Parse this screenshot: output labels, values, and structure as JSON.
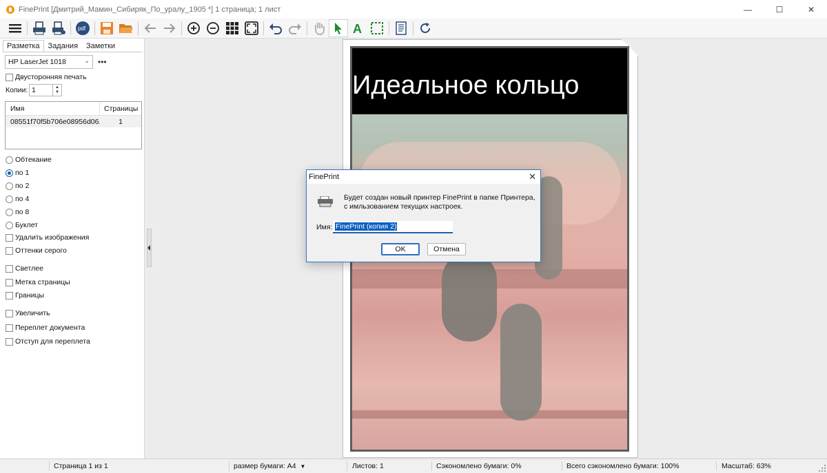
{
  "window": {
    "title": "FinePrint [Дмитрий_Мамин_Сибиряк_По_уралу_1905 *] 1 страница; 1 лист",
    "minimize": "—",
    "maximize": "☐",
    "close": "✕"
  },
  "toolbar": {
    "items": [
      "menu-icon",
      "print-icon",
      "print-settings-icon",
      "pdf-pro-icon",
      "save-icon",
      "open-folder-icon",
      "back-icon",
      "forward-icon",
      "zoom-in-icon",
      "zoom-out-icon",
      "grid-icon",
      "fit-page-icon",
      "undo-icon",
      "redo-icon",
      "hand-icon",
      "select-arrow-icon",
      "text-tool-icon",
      "marquee-icon",
      "page-setup-icon",
      "refresh-icon"
    ],
    "pdf_label": "pdf",
    "text_tool_glyph": "A"
  },
  "panel": {
    "tabs": [
      "Разметка",
      "Задания",
      "Заметки"
    ],
    "printer": "HP LaserJet 1018",
    "more": "•••",
    "duplex_label": "Двусторонняя печать",
    "copies_label": "Копии:",
    "copies_value": "1",
    "table": {
      "headers": [
        "Имя",
        "Страницы"
      ],
      "rows": [
        [
          "08551f70f5b706e08956d06...",
          "1"
        ]
      ]
    },
    "radios": [
      "Обтекание",
      "по 1",
      "по 2",
      "по 4",
      "по 8",
      "Буклет"
    ],
    "checks_a": [
      "Удалить изображения",
      "Оттенки серого"
    ],
    "checks_b": [
      "Светлее",
      "Метка страницы",
      "Границы"
    ],
    "checks_c": [
      "Увеличить"
    ],
    "checks_d": [
      "Переплет документа",
      "Отступ для переплета"
    ]
  },
  "preview": {
    "image_title": "Идеальное кольцо"
  },
  "dialog": {
    "title": "FinePrint",
    "close": "✕",
    "message": "Будет создан новый принтер FinePrint в папке Принтера, с имльзованием текущих настроек.",
    "name_label": "Имя:",
    "name_value": "FinePrint (копия 2)",
    "ok": "OK",
    "cancel": "Отмена"
  },
  "status": {
    "page": "Страница 1 из 1",
    "paper": "размер бумаги: A4",
    "sheets": "Листов: 1",
    "saved": "Сэкономлено бумаги: 0%",
    "total_saved": "Всего сэкономлено бумаги: 100%",
    "zoom": "Масштаб: 63%"
  }
}
